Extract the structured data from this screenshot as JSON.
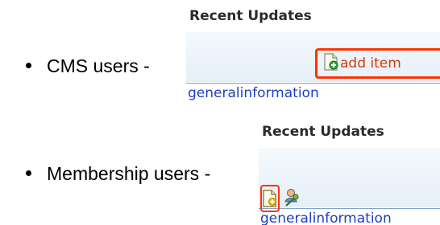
{
  "bullets": [
    {
      "label": "CMS users -",
      "panel": {
        "header": "Recent Updates",
        "action_label": "add item",
        "link": "generalinformation",
        "icons": [
          "add-document-icon"
        ]
      }
    },
    {
      "label": "Membership users -",
      "panel": {
        "header": "Recent Updates",
        "link": "generalinformation",
        "icons": [
          "add-document-icon",
          "user-pin-icon"
        ]
      }
    }
  ],
  "colors": {
    "highlight": "#ff3300",
    "link": "#1f3ec0",
    "header_text": "#2b2b2b",
    "toolbar_bg": "#e6eff8"
  }
}
